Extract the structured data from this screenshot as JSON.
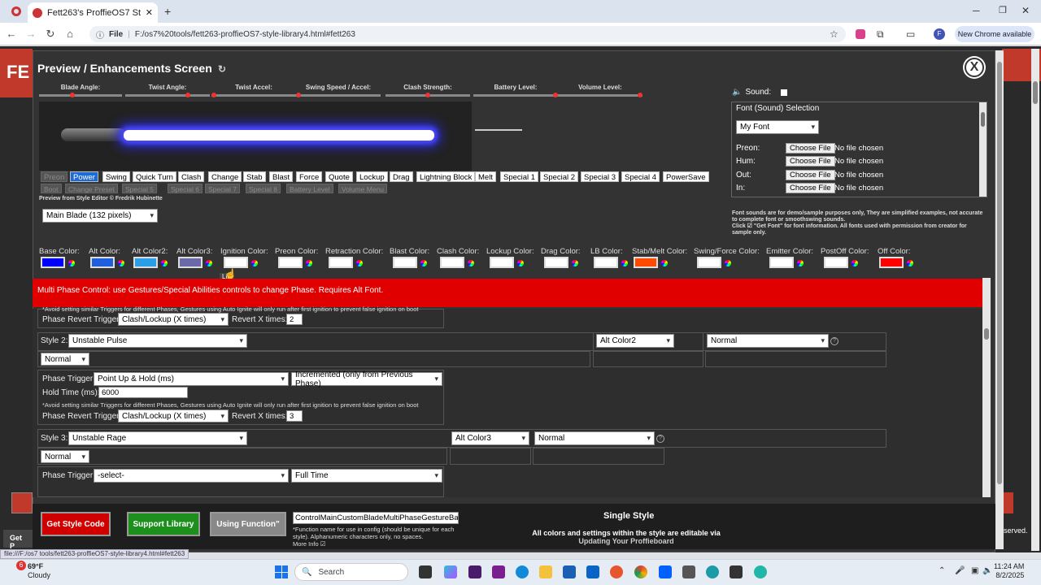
{
  "browser": {
    "tab_title": "Fett263's ProffieOS7 Style Libra",
    "url_chip": "File",
    "url": "F:/os7%20tools/fett263-proffieOS7-style-library4.html#fett263",
    "new_chrome": "New Chrome available",
    "status_url": "file:///F:/os7 tools/fett263-proffieOS7-style-library4.html#fett263"
  },
  "background": {
    "left_logo": "FE",
    "right_text": "served.",
    "left_button": "Get P"
  },
  "modal": {
    "title": "Preview / Enhancements Screen",
    "close": "X",
    "sliders": [
      {
        "label": "Blade Angle:",
        "value": 0.4
      },
      {
        "label": "Twist Angle:",
        "value": 0.75
      },
      {
        "label": "Twist Accel:",
        "value": 0.0
      },
      {
        "label": "Swing Speed / Accel:",
        "value": 0.0
      },
      {
        "label": "Clash Strength:",
        "value": 0.5
      },
      {
        "label": "Battery Level:",
        "value": 1.0
      },
      {
        "label": "Volume Level:",
        "value": 1.0
      }
    ],
    "effects_row1": [
      "Preon",
      "Power",
      "Swing",
      "Quick Turn",
      "Clash",
      "Change",
      "Stab",
      "Blast",
      "Force",
      "Quote",
      "Lockup",
      "Drag",
      "Lightning Block",
      "Melt",
      "Special 1",
      "Special 2",
      "Special 3",
      "Special 4",
      "PowerSave"
    ],
    "effects_row2": [
      "Boot",
      "Change Preset",
      "Special 5",
      "Special 6",
      "Special 7",
      "Special 8",
      "Battery Level",
      "Volume Menu"
    ],
    "credit": "Preview from Style Editor © Fredrik Hubinette",
    "blade_select": "Main Blade (132 pixels)",
    "sound_label": "Sound:",
    "font_title": "Font (Sound) Selection",
    "font_select": "My Font",
    "font_rows": [
      {
        "label": "Preon:",
        "button": "Choose File",
        "status": "No file chosen"
      },
      {
        "label": "Hum:",
        "button": "Choose File",
        "status": "No file chosen"
      },
      {
        "label": "Out:",
        "button": "Choose File",
        "status": "No file chosen"
      },
      {
        "label": "In:",
        "button": "Choose File",
        "status": "No file chosen"
      }
    ],
    "font_note1": "Font sounds are for demo/sample purposes only, They are simplified examples, not accurate to complete font or smoothswing sounds.",
    "font_note2": "Click ☑ \"Get Font\" for font information. All fonts used with permission from creator for sample only.",
    "colors": [
      {
        "label": "Base Color:",
        "color": "#0000ff"
      },
      {
        "label": "Alt Color:",
        "color": "#1e5fe0"
      },
      {
        "label": "Alt Color2:",
        "color": "#2a9fe8"
      },
      {
        "label": "Alt Color3:",
        "color": "#6a6aa8"
      },
      {
        "label": "Ignition Color:",
        "color": "#ffffff"
      },
      {
        "label": "Preon Color:",
        "color": "#ffffff"
      },
      {
        "label": "Retraction Color:",
        "color": "#ffffff"
      },
      {
        "label": "Blast Color:",
        "color": "#ffffff"
      },
      {
        "label": "Clash Color:",
        "color": "#ffffff"
      },
      {
        "label": "Lockup Color:",
        "color": "#ffffff"
      },
      {
        "label": "Drag Color:",
        "color": "#ffffff"
      },
      {
        "label": "LB Color:",
        "color": "#ffffff"
      },
      {
        "label": "Stab/Melt Color:",
        "color": "#ff4a00"
      },
      {
        "label": "Swing/Force Color:",
        "color": "#ffffff"
      },
      {
        "label": "Emitter Color:",
        "color": "#ffffff"
      },
      {
        "label": "PostOff Color:",
        "color": "#ffffff"
      },
      {
        "label": "Off Color:",
        "color": "#ff0000"
      }
    ],
    "tooltip": "List",
    "banner": "Multi Phase Control: use Gestures/Special Abilities controls to change Phase. Requires Alt Font.",
    "phase": {
      "top_note": "*Avoid setting similar Triggers for different Phases, Gestures using Auto Ignite will only run after first ignition to prevent false ignition on boot",
      "revert_label": "Phase Revert Trigger",
      "revert_select": "Clash/Lockup (X times)",
      "revert_x_label": "Revert X times:",
      "revert_x_1": "2",
      "style2_label": "Style 2:",
      "style2_select": "Unstable Pulse",
      "style2_color": "Alt Color2",
      "style2_mode": "Normal",
      "style2_sub": "Normal",
      "trigger_label": "Phase Trigger:",
      "trigger2_select": "Point Up & Hold (ms)",
      "trigger2_mode": "Incremented (only from Previous Phase)",
      "hold_label": "Hold Time (ms):",
      "hold_value": "6000",
      "note2": "*Avoid setting similar Triggers for different Phases, Gestures using Auto Ignite will only run after first ignition to prevent false ignition on boot",
      "revert_select2": "Clash/Lockup (X times)",
      "revert_x_2": "3",
      "style3_label": "Style 3:",
      "style3_select": "Unstable Rage",
      "style3_color": "Alt Color3",
      "style3_mode": "Normal",
      "style3_sub": "Normal",
      "trigger3_select": "-select-",
      "trigger3_mode": "Full Time",
      "help": "?"
    }
  },
  "footer": {
    "get_style": "Get Style Code",
    "support": "Support Library",
    "using_function": "Using Function\"",
    "function_name": "ControlMainCustomBladeMultiPhaseGestureBas",
    "function_note": "*Function name for use in config (should be unique for each style). Alphanumeric characters only, no spaces.",
    "more_info": "More Info ☑",
    "single_style": "Single Style",
    "edit_note1": "All colors and settings within the style are editable via",
    "edit_note2": "Updating Your Proffieboard"
  },
  "taskbar": {
    "weather_temp": "69°F",
    "weather_desc": "Cloudy",
    "notif": "6",
    "search": "Search",
    "time": "11:24 AM",
    "date": "8/2/2025"
  }
}
